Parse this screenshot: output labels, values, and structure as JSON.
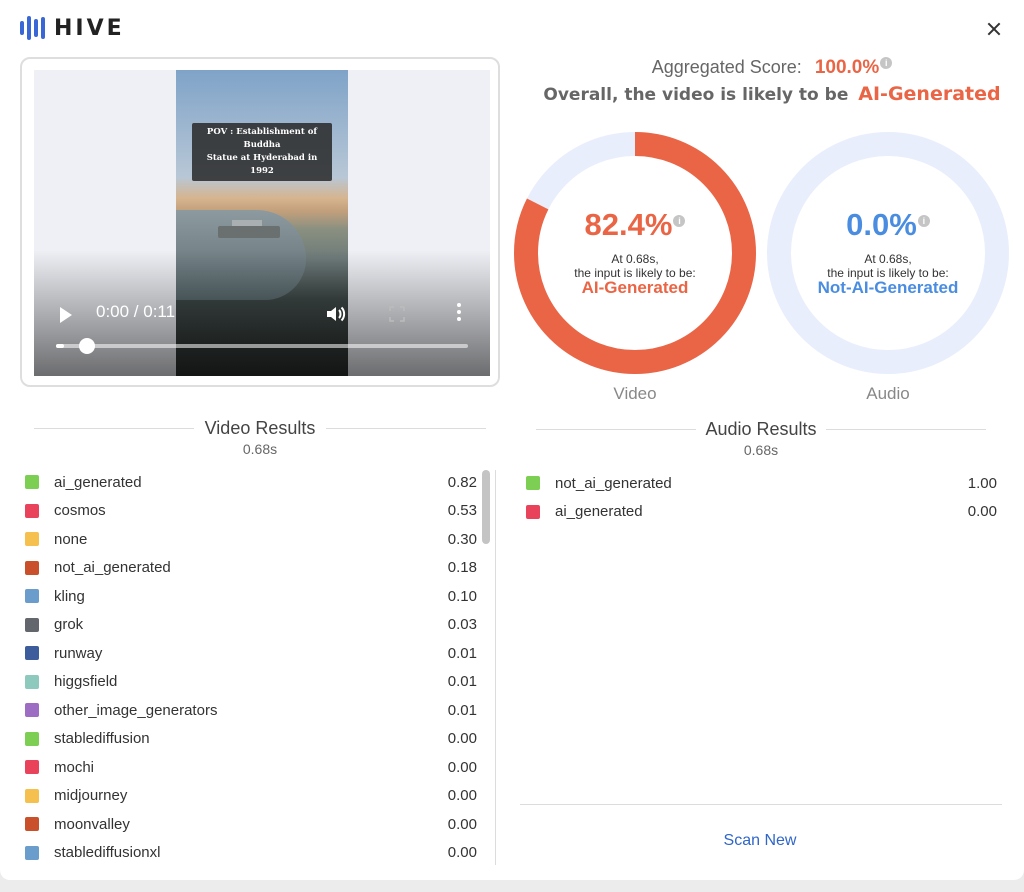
{
  "app": {
    "logo_text": "HIVE"
  },
  "video": {
    "overlay_caption_line1": "POV : Establishment of Buddha",
    "overlay_caption_line2": "Statue at Hyderabad in 1992",
    "time": "0:00 / 0:11",
    "progress": 0.02
  },
  "aggregate": {
    "label": "Aggregated Score:",
    "score": "100.0%",
    "overall_prefix": "Overall, the video is likely to be",
    "overall_result": "AI-Generated",
    "info_icon": "i"
  },
  "donuts": [
    {
      "name": "Video",
      "score": "82.4%",
      "value": 0.824,
      "at": "At 0.68s,",
      "likely": "the input is likely to be:",
      "verdict": "AI-Generated",
      "color": "#ea6545",
      "track": "#e8eefb"
    },
    {
      "name": "Audio",
      "score": "0.0%",
      "value": 0.0,
      "at": "At 0.68s,",
      "likely": "the input is likely to be:",
      "verdict": "Not-AI-Generated",
      "color": "#4a8de0",
      "track": "#e8eefb"
    }
  ],
  "video_results": {
    "title": "Video Results",
    "time": "0.68s",
    "rows": [
      {
        "label": "ai_generated",
        "value": "0.82",
        "color": "#7ccf52"
      },
      {
        "label": "cosmos",
        "value": "0.53",
        "color": "#e9435b"
      },
      {
        "label": "none",
        "value": "0.30",
        "color": "#f5c04e"
      },
      {
        "label": "not_ai_generated",
        "value": "0.18",
        "color": "#c9502b"
      },
      {
        "label": "kling",
        "value": "0.10",
        "color": "#6a9ccc"
      },
      {
        "label": "grok",
        "value": "0.03",
        "color": "#63666d"
      },
      {
        "label": "runway",
        "value": "0.01",
        "color": "#3d5c9c"
      },
      {
        "label": "higgsfield",
        "value": "0.01",
        "color": "#8ec9bd"
      },
      {
        "label": "other_image_generators",
        "value": "0.01",
        "color": "#9d6cc3"
      },
      {
        "label": "stablediffusion",
        "value": "0.00",
        "color": "#7ccf52"
      },
      {
        "label": "mochi",
        "value": "0.00",
        "color": "#e9435b"
      },
      {
        "label": "midjourney",
        "value": "0.00",
        "color": "#f5c04e"
      },
      {
        "label": "moonvalley",
        "value": "0.00",
        "color": "#c9502b"
      },
      {
        "label": "stablediffusionxl",
        "value": "0.00",
        "color": "#6a9ccc"
      }
    ]
  },
  "audio_results": {
    "title": "Audio Results",
    "time": "0.68s",
    "rows": [
      {
        "label": "not_ai_generated",
        "value": "1.00",
        "color": "#7ccf52"
      },
      {
        "label": "ai_generated",
        "value": "0.00",
        "color": "#e9435b"
      }
    ]
  },
  "actions": {
    "scan_new": "Scan New"
  }
}
